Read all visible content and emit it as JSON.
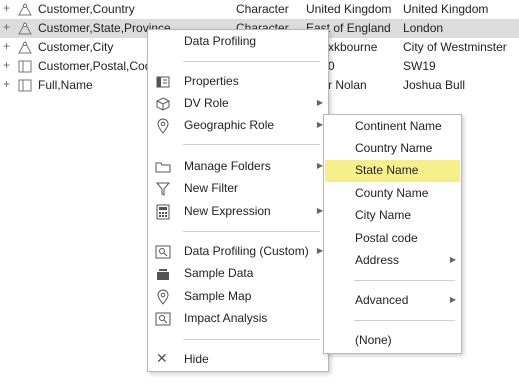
{
  "rows": [
    {
      "name": "Customer,Country",
      "type": "Character",
      "col3": "United Kingdom",
      "col4": "United Kingdom",
      "icon": "hierarchy-icon",
      "selected": false
    },
    {
      "name": "Customer,State,Province",
      "type": "Character",
      "col3": "East of England",
      "col4": "London",
      "icon": "hierarchy-icon",
      "selected": true
    },
    {
      "name": "Customer,City",
      "type": "",
      "col3": "xkbourne",
      "col4": "City of Westminster",
      "icon": "hierarchy-icon",
      "selected": false
    },
    {
      "name": "Customer,Postal,Cod",
      "type": "",
      "col3": "0",
      "col4": "SW19",
      "icon": "list-icon",
      "selected": false
    },
    {
      "name": "Full,Name",
      "type": "",
      "col3": "r Nolan",
      "col4": "Joshua Bull",
      "icon": "list-icon",
      "selected": false
    }
  ],
  "context_menu": {
    "items": [
      {
        "label": "Data Profiling",
        "icon": "",
        "submenu": false
      },
      {
        "label": "Properties",
        "icon": "properties-icon",
        "submenu": false
      },
      {
        "label": "DV Role",
        "icon": "cube-icon",
        "submenu": true
      },
      {
        "label": "Geographic Role",
        "icon": "map-pin-icon",
        "submenu": true
      },
      {
        "label": "Manage Folders",
        "icon": "folder-icon",
        "submenu": true
      },
      {
        "label": "New Filter",
        "icon": "filter-icon",
        "submenu": false
      },
      {
        "label": "New Expression",
        "icon": "calculator-icon",
        "submenu": true
      },
      {
        "label": "Data Profiling (Custom)",
        "icon": "profile-icon",
        "submenu": true
      },
      {
        "label": "Sample Data",
        "icon": "sample-data-icon",
        "submenu": false
      },
      {
        "label": "Sample Map",
        "icon": "map-pin-icon",
        "submenu": false
      },
      {
        "label": "Impact Analysis",
        "icon": "impact-icon",
        "submenu": false
      },
      {
        "label": "Hide",
        "icon": "close-icon",
        "submenu": false
      }
    ]
  },
  "geo_submenu": {
    "items": [
      {
        "label": "Continent Name",
        "submenu": false,
        "highlighted": false
      },
      {
        "label": "Country Name",
        "submenu": false,
        "highlighted": false
      },
      {
        "label": "State Name",
        "submenu": false,
        "highlighted": true
      },
      {
        "label": "County Name",
        "submenu": false,
        "highlighted": false
      },
      {
        "label": "City Name",
        "submenu": false,
        "highlighted": false
      },
      {
        "label": "Postal code",
        "submenu": false,
        "highlighted": false
      },
      {
        "label": "Address",
        "submenu": true,
        "highlighted": false
      },
      {
        "label": "Advanced",
        "submenu": true,
        "highlighted": false
      },
      {
        "label": "(None)",
        "submenu": false,
        "highlighted": false
      }
    ]
  },
  "colors": {
    "highlight": "#f7ef8a",
    "selected_row": "#dcdcdc",
    "border": "#b8b8b8"
  }
}
